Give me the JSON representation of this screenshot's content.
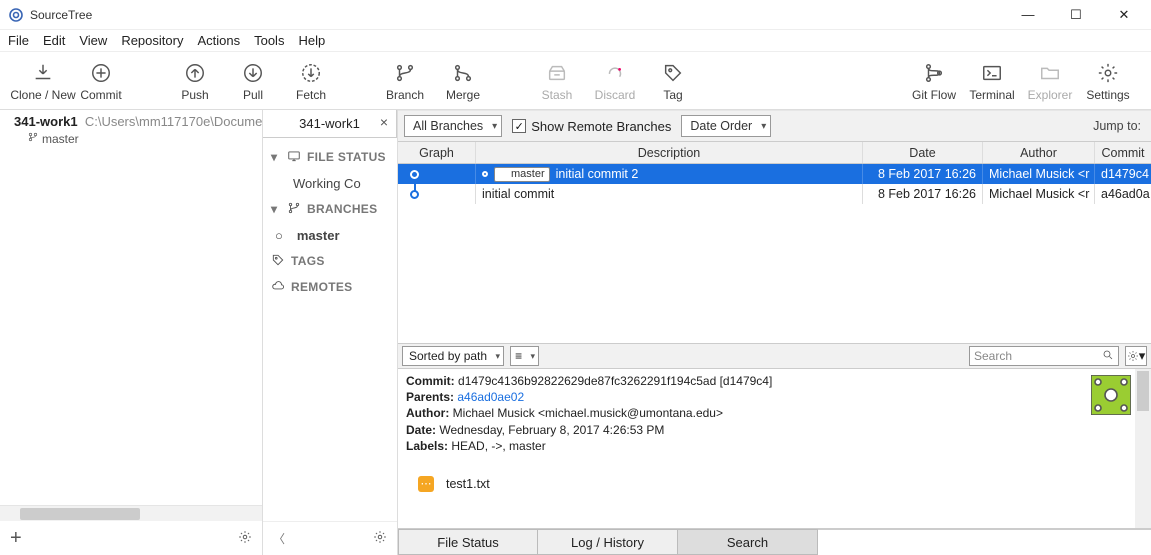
{
  "window": {
    "title": "SourceTree"
  },
  "menu": [
    "File",
    "Edit",
    "View",
    "Repository",
    "Actions",
    "Tools",
    "Help"
  ],
  "toolbar": {
    "left": [
      {
        "name": "clone-new",
        "label": "Clone / New",
        "icon": "download"
      },
      {
        "name": "commit",
        "label": "Commit",
        "icon": "plus-circle"
      }
    ],
    "mid": [
      {
        "name": "push",
        "label": "Push",
        "icon": "arrow-up"
      },
      {
        "name": "pull",
        "label": "Pull",
        "icon": "arrow-down"
      },
      {
        "name": "fetch",
        "label": "Fetch",
        "icon": "refresh"
      }
    ],
    "mid2": [
      {
        "name": "branch",
        "label": "Branch",
        "icon": "branch"
      },
      {
        "name": "merge",
        "label": "Merge",
        "icon": "merge"
      }
    ],
    "mid3": [
      {
        "name": "stash",
        "label": "Stash",
        "icon": "stash",
        "disabled": true
      },
      {
        "name": "discard",
        "label": "Discard",
        "icon": "undo",
        "disabled": true
      },
      {
        "name": "tag",
        "label": "Tag",
        "icon": "tag"
      }
    ],
    "right": [
      {
        "name": "git-flow",
        "label": "Git Flow",
        "icon": "flow"
      },
      {
        "name": "terminal",
        "label": "Terminal",
        "icon": "terminal"
      },
      {
        "name": "explorer",
        "label": "Explorer",
        "icon": "folder",
        "disabled": true
      },
      {
        "name": "settings",
        "label": "Settings",
        "icon": "gear"
      }
    ]
  },
  "repoList": {
    "name": "341-work1",
    "path": "C:\\Users\\mm117170e\\Documen",
    "branch": "master"
  },
  "sidebar": {
    "tabName": "341-work1",
    "sections": {
      "fileStatus": {
        "label": "FILE STATUS",
        "item": "Working Co"
      },
      "branches": {
        "label": "BRANCHES",
        "current": "master"
      },
      "tags": {
        "label": "TAGS"
      },
      "remotes": {
        "label": "REMOTES"
      }
    }
  },
  "filters": {
    "branches": "All Branches",
    "showRemote": "Show Remote Branches",
    "order": "Date Order",
    "jump": "Jump to:"
  },
  "columns": {
    "graph": "Graph",
    "desc": "Description",
    "date": "Date",
    "author": "Author",
    "commit": "Commit"
  },
  "commits": [
    {
      "selected": true,
      "branchBadge": "master",
      "message": "initial commit 2",
      "date": "8 Feb 2017 16:26",
      "author": "Michael Musick <r",
      "sha": "d1479c4"
    },
    {
      "selected": false,
      "branchBadge": "",
      "message": "initial commit",
      "date": "8 Feb 2017 16:26",
      "author": "Michael Musick <r",
      "sha": "a46ad0a"
    }
  ],
  "detailsBar": {
    "sort": "Sorted by path",
    "view": "≡",
    "searchPlaceholder": "Search"
  },
  "details": {
    "commitLabel": "Commit:",
    "commit": "d1479c4136b92822629de87fc3262291f194c5ad [d1479c4]",
    "parentsLabel": "Parents:",
    "parents": "a46ad0ae02",
    "authorLabel": "Author:",
    "author": "Michael Musick <michael.musick@umontana.edu>",
    "dateLabel": "Date:",
    "date": "Wednesday, February 8, 2017 4:26:53 PM",
    "labelsLabel": "Labels:",
    "labels": "HEAD, ->, master",
    "file": "test1.txt"
  },
  "footTabs": {
    "fileStatus": "File Status",
    "log": "Log / History",
    "search": "Search"
  }
}
